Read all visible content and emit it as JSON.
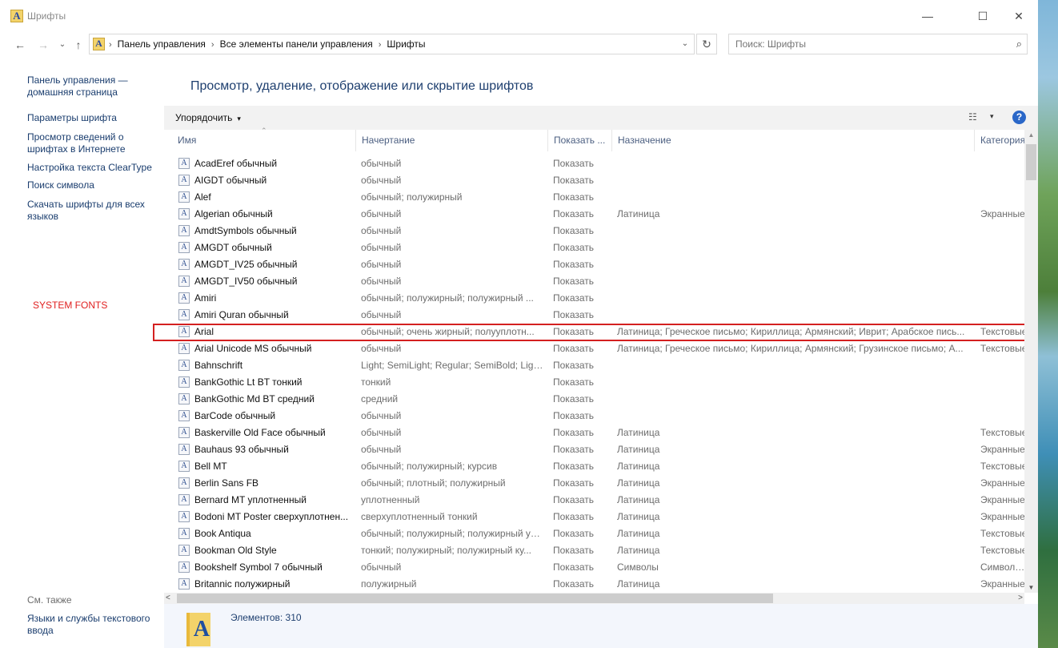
{
  "window": {
    "title": "Шрифты",
    "minimize_glyph": "—",
    "maximize_glyph": "☐",
    "close_glyph": "✕"
  },
  "icons": {
    "app": "font-folder-icon",
    "back": "arrow-left-icon",
    "forward": "arrow-right-icon",
    "recent": "chevron-down-icon",
    "up": "arrow-up-icon",
    "refresh": "refresh-icon",
    "search": "search-icon",
    "help": "help-icon",
    "view": "view-details-icon",
    "font_file": "font-file-icon"
  },
  "nav": {
    "back_glyph": "←",
    "forward_glyph": "→",
    "recent_glyph": "⌄",
    "up_glyph": "↑",
    "refresh_glyph": "↻",
    "dropdown_glyph": "⌄"
  },
  "address": {
    "breadcrumbs": [
      "Панель управления",
      "Все элементы панели управления",
      "Шрифты"
    ],
    "separator": "›"
  },
  "search": {
    "placeholder": "Поиск: Шрифты",
    "glyph": "⌕"
  },
  "sidebar": {
    "items": [
      {
        "label": "Панель управления — домашняя страница"
      },
      {
        "label": "Параметры шрифта"
      },
      {
        "label": "Просмотр сведений о шрифтах в Интернете"
      },
      {
        "label": "Настройка текста ClearType"
      },
      {
        "label": "Поиск символа"
      },
      {
        "label": "Скачать шрифты для всех языков"
      }
    ],
    "annotation": "SYSTEM FONTS",
    "see_also_title": "См. также",
    "see_also_items": [
      {
        "label": "Языки и службы текстового ввода"
      }
    ]
  },
  "main": {
    "title": "Просмотр, удаление, отображение или скрытие шрифтов",
    "organize_label": "Упорядочить",
    "organize_caret": "▾",
    "view_glyph": "☷",
    "view_caret": "▾",
    "help_glyph": "?"
  },
  "table": {
    "columns": [
      "Имя",
      "Начертание",
      "Показать ...",
      "Назначение",
      "Категория"
    ],
    "sort_glyph": "⌃",
    "rows": [
      {
        "name": "AcadEref обычный",
        "style": "обычный",
        "show": "Показать",
        "purpose": "",
        "category": ""
      },
      {
        "name": "AIGDT обычный",
        "style": "обычный",
        "show": "Показать",
        "purpose": "",
        "category": ""
      },
      {
        "name": "Alef",
        "style": "обычный; полужирный",
        "show": "Показать",
        "purpose": "",
        "category": ""
      },
      {
        "name": "Algerian обычный",
        "style": "обычный",
        "show": "Показать",
        "purpose": "Латиница",
        "category": "Экранные"
      },
      {
        "name": "AmdtSymbols обычный",
        "style": "обычный",
        "show": "Показать",
        "purpose": "",
        "category": ""
      },
      {
        "name": "AMGDT обычный",
        "style": "обычный",
        "show": "Показать",
        "purpose": "",
        "category": ""
      },
      {
        "name": "AMGDT_IV25 обычный",
        "style": "обычный",
        "show": "Показать",
        "purpose": "",
        "category": ""
      },
      {
        "name": "AMGDT_IV50 обычный",
        "style": "обычный",
        "show": "Показать",
        "purpose": "",
        "category": ""
      },
      {
        "name": "Amiri",
        "style": "обычный; полужирный; полужирный ...",
        "show": "Показать",
        "purpose": "",
        "category": ""
      },
      {
        "name": "Amiri Quran обычный",
        "style": "обычный",
        "show": "Показать",
        "purpose": "",
        "category": ""
      },
      {
        "name": "Arial",
        "style": "обычный; очень жирный; полууплотн...",
        "show": "Показать",
        "purpose": "Латиница; Греческое письмо; Кириллица; Армянский; Иврит; Арабское пись...",
        "category": "Текстовые"
      },
      {
        "name": "Arial Unicode MS обычный",
        "style": "обычный",
        "show": "Показать",
        "purpose": "Латиница; Греческое письмо; Кириллица; Армянский; Грузинское письмо; А...",
        "category": "Текстовые"
      },
      {
        "name": "Bahnschrift",
        "style": "Light; SemiLight; Regular; SemiBold; Ligh...",
        "show": "Показать",
        "purpose": "",
        "category": ""
      },
      {
        "name": "BankGothic Lt BT тонкий",
        "style": "тонкий",
        "show": "Показать",
        "purpose": "",
        "category": ""
      },
      {
        "name": "BankGothic Md BT средний",
        "style": "средний",
        "show": "Показать",
        "purpose": "",
        "category": ""
      },
      {
        "name": "BarCode обычный",
        "style": "обычный",
        "show": "Показать",
        "purpose": "",
        "category": ""
      },
      {
        "name": "Baskerville Old Face обычный",
        "style": "обычный",
        "show": "Показать",
        "purpose": "Латиница",
        "category": "Текстовые"
      },
      {
        "name": "Bauhaus 93 обычный",
        "style": "обычный",
        "show": "Показать",
        "purpose": "Латиница",
        "category": "Экранные"
      },
      {
        "name": "Bell MT",
        "style": "обычный; полужирный; курсив",
        "show": "Показать",
        "purpose": "Латиница",
        "category": "Текстовые"
      },
      {
        "name": "Berlin Sans FB",
        "style": "обычный; плотный; полужирный",
        "show": "Показать",
        "purpose": "Латиница",
        "category": "Экранные"
      },
      {
        "name": "Bernard MT уплотненный",
        "style": "уплотненный",
        "show": "Показать",
        "purpose": "Латиница",
        "category": "Экранные"
      },
      {
        "name": "Bodoni MT Poster сверхуплотнен...",
        "style": "сверхуплотненный тонкий",
        "show": "Показать",
        "purpose": "Латиница",
        "category": "Экранные"
      },
      {
        "name": "Book Antiqua",
        "style": "обычный; полужирный; полужирный уплотн...",
        "show": "Показать",
        "purpose": "Латиница",
        "category": "Текстовые"
      },
      {
        "name": "Bookman Old Style",
        "style": "тонкий; полужирный; полужирный ку...",
        "show": "Показать",
        "purpose": "Латиница",
        "category": "Текстовые"
      },
      {
        "name": "Bookshelf Symbol 7 обычный",
        "style": "обычный",
        "show": "Показать",
        "purpose": "Символы",
        "category": "Символьные"
      },
      {
        "name": "Britannic полужирный",
        "style": "полужирный",
        "show": "Показать",
        "purpose": "Латиница",
        "category": "Экранные"
      }
    ]
  },
  "scroll": {
    "up_glyph": "▲",
    "down_glyph": "▼",
    "left_glyph": "<",
    "right_glyph": ">"
  },
  "details": {
    "count_label": "Элементов: 310",
    "icon_letter": "A"
  },
  "colors": {
    "link": "#1a3d6e",
    "title": "#1e3f6f",
    "annotation": "#e02020",
    "highlight_border": "#d42020",
    "details_bg": "#f3f6fc"
  }
}
